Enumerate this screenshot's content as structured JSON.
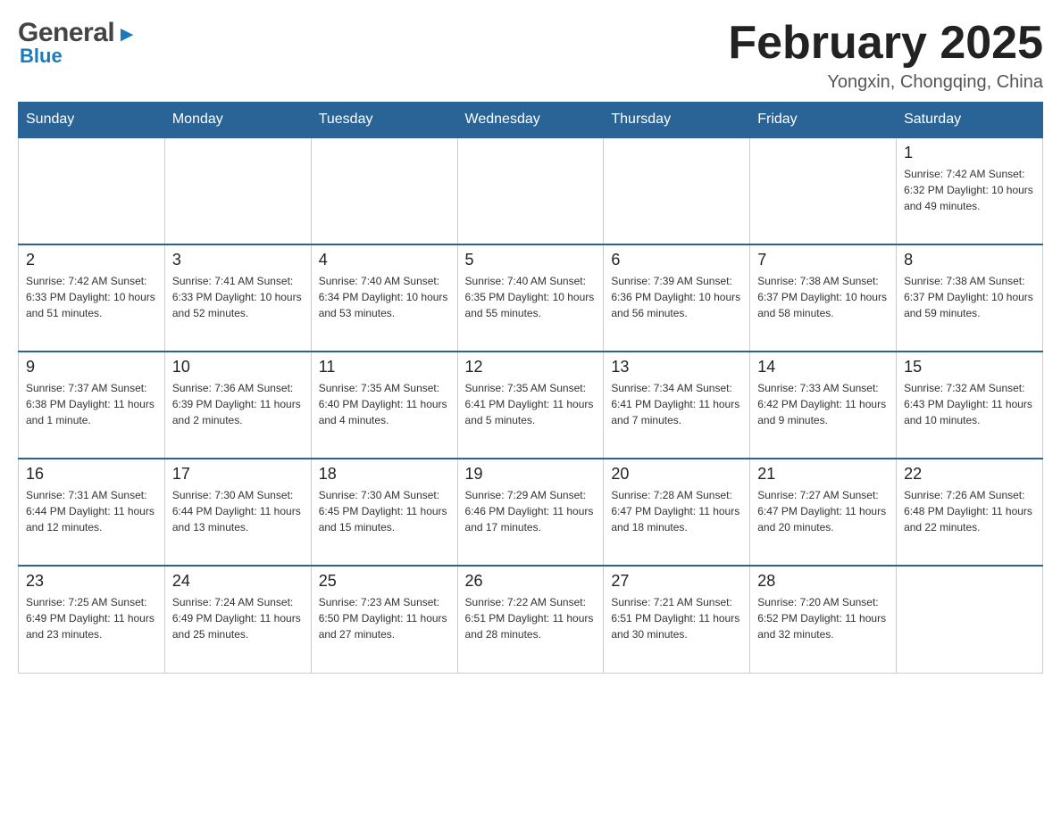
{
  "header": {
    "logo": {
      "general": "General",
      "blue": "Blue"
    },
    "title": "February 2025",
    "location": "Yongxin, Chongqing, China"
  },
  "calendar": {
    "days_of_week": [
      "Sunday",
      "Monday",
      "Tuesday",
      "Wednesday",
      "Thursday",
      "Friday",
      "Saturday"
    ],
    "weeks": [
      [
        {
          "day": "",
          "info": ""
        },
        {
          "day": "",
          "info": ""
        },
        {
          "day": "",
          "info": ""
        },
        {
          "day": "",
          "info": ""
        },
        {
          "day": "",
          "info": ""
        },
        {
          "day": "",
          "info": ""
        },
        {
          "day": "1",
          "info": "Sunrise: 7:42 AM\nSunset: 6:32 PM\nDaylight: 10 hours and 49 minutes."
        }
      ],
      [
        {
          "day": "2",
          "info": "Sunrise: 7:42 AM\nSunset: 6:33 PM\nDaylight: 10 hours and 51 minutes."
        },
        {
          "day": "3",
          "info": "Sunrise: 7:41 AM\nSunset: 6:33 PM\nDaylight: 10 hours and 52 minutes."
        },
        {
          "day": "4",
          "info": "Sunrise: 7:40 AM\nSunset: 6:34 PM\nDaylight: 10 hours and 53 minutes."
        },
        {
          "day": "5",
          "info": "Sunrise: 7:40 AM\nSunset: 6:35 PM\nDaylight: 10 hours and 55 minutes."
        },
        {
          "day": "6",
          "info": "Sunrise: 7:39 AM\nSunset: 6:36 PM\nDaylight: 10 hours and 56 minutes."
        },
        {
          "day": "7",
          "info": "Sunrise: 7:38 AM\nSunset: 6:37 PM\nDaylight: 10 hours and 58 minutes."
        },
        {
          "day": "8",
          "info": "Sunrise: 7:38 AM\nSunset: 6:37 PM\nDaylight: 10 hours and 59 minutes."
        }
      ],
      [
        {
          "day": "9",
          "info": "Sunrise: 7:37 AM\nSunset: 6:38 PM\nDaylight: 11 hours and 1 minute."
        },
        {
          "day": "10",
          "info": "Sunrise: 7:36 AM\nSunset: 6:39 PM\nDaylight: 11 hours and 2 minutes."
        },
        {
          "day": "11",
          "info": "Sunrise: 7:35 AM\nSunset: 6:40 PM\nDaylight: 11 hours and 4 minutes."
        },
        {
          "day": "12",
          "info": "Sunrise: 7:35 AM\nSunset: 6:41 PM\nDaylight: 11 hours and 5 minutes."
        },
        {
          "day": "13",
          "info": "Sunrise: 7:34 AM\nSunset: 6:41 PM\nDaylight: 11 hours and 7 minutes."
        },
        {
          "day": "14",
          "info": "Sunrise: 7:33 AM\nSunset: 6:42 PM\nDaylight: 11 hours and 9 minutes."
        },
        {
          "day": "15",
          "info": "Sunrise: 7:32 AM\nSunset: 6:43 PM\nDaylight: 11 hours and 10 minutes."
        }
      ],
      [
        {
          "day": "16",
          "info": "Sunrise: 7:31 AM\nSunset: 6:44 PM\nDaylight: 11 hours and 12 minutes."
        },
        {
          "day": "17",
          "info": "Sunrise: 7:30 AM\nSunset: 6:44 PM\nDaylight: 11 hours and 13 minutes."
        },
        {
          "day": "18",
          "info": "Sunrise: 7:30 AM\nSunset: 6:45 PM\nDaylight: 11 hours and 15 minutes."
        },
        {
          "day": "19",
          "info": "Sunrise: 7:29 AM\nSunset: 6:46 PM\nDaylight: 11 hours and 17 minutes."
        },
        {
          "day": "20",
          "info": "Sunrise: 7:28 AM\nSunset: 6:47 PM\nDaylight: 11 hours and 18 minutes."
        },
        {
          "day": "21",
          "info": "Sunrise: 7:27 AM\nSunset: 6:47 PM\nDaylight: 11 hours and 20 minutes."
        },
        {
          "day": "22",
          "info": "Sunrise: 7:26 AM\nSunset: 6:48 PM\nDaylight: 11 hours and 22 minutes."
        }
      ],
      [
        {
          "day": "23",
          "info": "Sunrise: 7:25 AM\nSunset: 6:49 PM\nDaylight: 11 hours and 23 minutes."
        },
        {
          "day": "24",
          "info": "Sunrise: 7:24 AM\nSunset: 6:49 PM\nDaylight: 11 hours and 25 minutes."
        },
        {
          "day": "25",
          "info": "Sunrise: 7:23 AM\nSunset: 6:50 PM\nDaylight: 11 hours and 27 minutes."
        },
        {
          "day": "26",
          "info": "Sunrise: 7:22 AM\nSunset: 6:51 PM\nDaylight: 11 hours and 28 minutes."
        },
        {
          "day": "27",
          "info": "Sunrise: 7:21 AM\nSunset: 6:51 PM\nDaylight: 11 hours and 30 minutes."
        },
        {
          "day": "28",
          "info": "Sunrise: 7:20 AM\nSunset: 6:52 PM\nDaylight: 11 hours and 32 minutes."
        },
        {
          "day": "",
          "info": ""
        }
      ]
    ]
  }
}
